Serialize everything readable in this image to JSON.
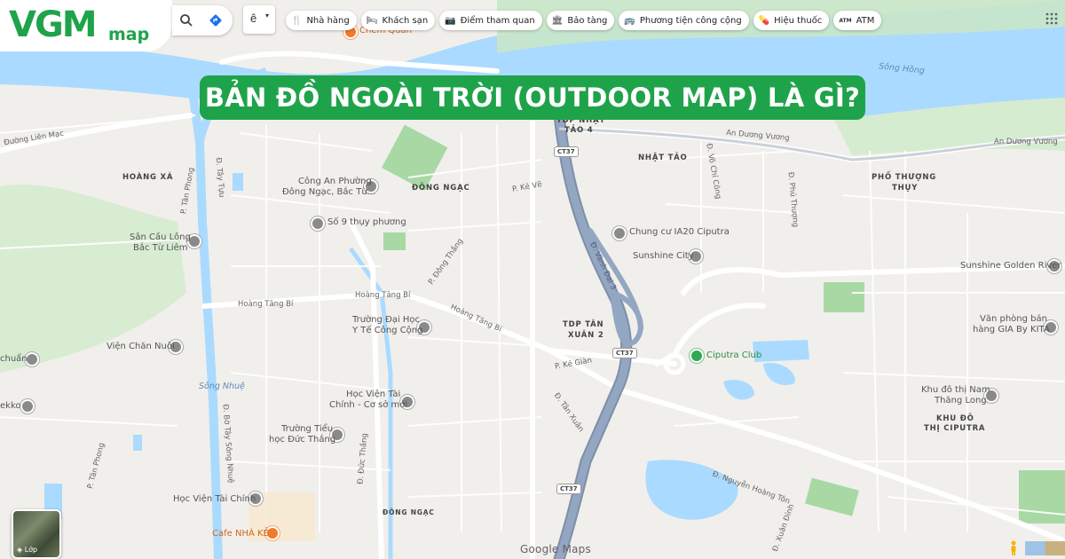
{
  "brand": {
    "logo_main": "VGM",
    "logo_sub": "map",
    "accent_color": "#1fa34a"
  },
  "headline": "BẢN ĐỒ NGOÀI TRỜI (OUTDOOR MAP) LÀ GÌ?",
  "toolbar": {
    "search_icon": "search-icon",
    "directions_icon": "directions-icon",
    "language_label": "ê",
    "language_caret": "▾",
    "apps_icon": "apps-grid-icon"
  },
  "categories": [
    {
      "icon": "🍴",
      "label": "Nhà hàng"
    },
    {
      "icon": "🛏",
      "label": "Khách sạn"
    },
    {
      "icon": "📷",
      "label": "Điểm tham quan"
    },
    {
      "icon": "🏛",
      "label": "Bảo tàng"
    },
    {
      "icon": "🚌",
      "label": "Phương tiện công cộng"
    },
    {
      "icon": "💊",
      "label": "Hiệu thuốc"
    },
    {
      "icon": "ATM",
      "label": "ATM"
    }
  ],
  "map": {
    "areas": [
      "HOÀNG XÁ",
      "ĐÔNG NGẠC",
      "NHẬT TẢO",
      "PHỐ THƯỢNG",
      "THỤY",
      "TDP NHẬT",
      "TẢO 4",
      "TDP TÂN",
      "XUÂN 2",
      "KHU ĐÔ",
      "THỊ CIPUTRA",
      "ĐÔNG NGẠC"
    ],
    "pois": [
      "Chem Quán",
      "Công An Phường",
      "Đông Ngạc, Bắc Từ...",
      "Số 9 thụy phương",
      "Sân Cầu Lông",
      "Bắc Từ Liêm",
      "Viện Chăn Nuôi",
      "Trường Đại Học",
      "Y Tế Công Cộng",
      "Học Viện Tài",
      "Chính - Cơ sở mới",
      "Trường Tiểu",
      "học Đức Thắng",
      "Học Viện Tài Chính",
      "Cafe NHÀ KẺ",
      "Chung cư IA20 Ciputra",
      "Sunshine City",
      "Ciputra Club",
      "Sunshine Golden River",
      "Văn phòng bán",
      "hàng GIA By KITA",
      "Khu đô thị Nam",
      "Thăng Long",
      "chuẩn",
      "ekko"
    ],
    "streets": [
      "Đường Liên Mạc",
      "An Dương Vương",
      "An Dương Vương",
      "Hoàng Tăng Bí",
      "Hoàng Tăng Bí",
      "Hoàng Tăng Bí",
      "P. Tân Phong",
      "Đ. Tây Tựu",
      "Đ. Bờ Tây Sông Nhuệ",
      "P. Kẻ Vẽ",
      "P. Đông Thắng",
      "P. Kẻ Giàn",
      "Đ. Tân Xuân",
      "Đ. Đức Thắng",
      "P. Tân Phong",
      "Đ. Nguyễn Hoàng Tôn",
      "Đ. Xuân Đỉnh",
      "Đ. Phú Thượng",
      "Đ. Võ Chí Công",
      "Đ. Vành Đai 3"
    ],
    "water": [
      "Sông Hồng",
      "Sông Nhuệ"
    ],
    "road_badges": [
      "CT37",
      "CT37",
      "CT37"
    ],
    "colors": {
      "land": "#f1efeb",
      "water": "#aadaff",
      "park": "#c8e6c9",
      "highway": "#8ea2bf",
      "road": "#ffffff"
    }
  },
  "controls": {
    "layers_label": "Lớp",
    "attribution": "Google Maps"
  }
}
